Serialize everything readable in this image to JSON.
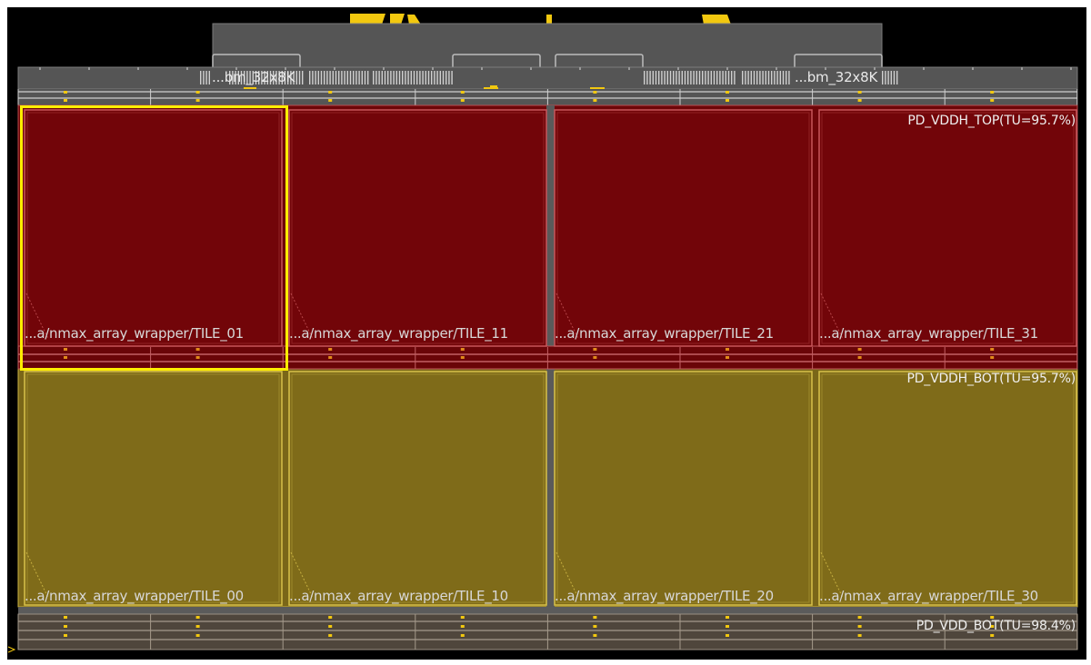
{
  "memories": {
    "left_label": "...bm_32x8K",
    "right_label": "...bm_32x8K"
  },
  "tiles": {
    "top_row": [
      {
        "name": "...a/nmax_array_wrapper/TILE_01",
        "selected": true
      },
      {
        "name": "...a/nmax_array_wrapper/TILE_11",
        "selected": false
      },
      {
        "name": "...a/nmax_array_wrapper/TILE_21",
        "selected": false
      },
      {
        "name": "...a/nmax_array_wrapper/TILE_31",
        "selected": false
      }
    ],
    "bottom_row": [
      {
        "name": "...a/nmax_array_wrapper/TILE_00",
        "selected": false
      },
      {
        "name": "...a/nmax_array_wrapper/TILE_10",
        "selected": false
      },
      {
        "name": "...a/nmax_array_wrapper/TILE_20",
        "selected": false
      },
      {
        "name": "...a/nmax_array_wrapper/TILE_30",
        "selected": false
      }
    ]
  },
  "power_domains": {
    "top": "PD_VDDH_TOP(TU=95.7%)",
    "bottom": "PD_VDDH_BOT(TU=95.7%)",
    "vdd_bottom": "PD_VDD_BOT(TU=98.4%)"
  },
  "colors": {
    "background": "#000000",
    "top_domain_fill": "#720509",
    "top_domain_border": "#c8565a",
    "bottom_domain_fill": "#7f6b19",
    "bottom_domain_border": "#d8c14a",
    "selection": "#ffee00",
    "grey_structure": "#595959",
    "pin_marker": "#f2c80f"
  }
}
